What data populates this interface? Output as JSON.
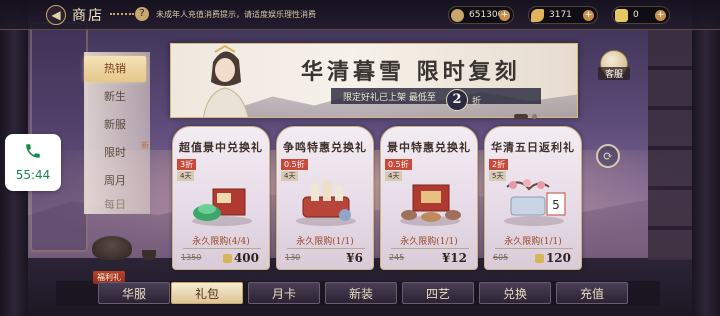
{
  "topbar": {
    "title": "商店",
    "notice": "未成年人充值消费提示，请适度娱乐理性消费",
    "help_symbol": "?",
    "back_symbol": "◀",
    "currencies": [
      {
        "icon": "coin-icon",
        "value": "651300"
      },
      {
        "icon": "feather-icon",
        "value": "3171"
      },
      {
        "icon": "ingot-icon",
        "value": "0"
      }
    ],
    "plus_symbol": "+"
  },
  "sidenav": {
    "items": [
      "热销",
      "新生",
      "新服",
      "限时",
      "周月",
      "每日"
    ],
    "active_index": 0,
    "new_tag": "新"
  },
  "banner": {
    "title": "华清暮雪 限时复刻",
    "subtitle": "限定好礼已上架 最低至",
    "discount": "2",
    "discount_suffix": "折"
  },
  "service": {
    "label": "客服"
  },
  "refresh_symbol": "⟳",
  "cards": [
    {
      "title": "超值景中兑换礼",
      "badge": "3折",
      "days": "4天",
      "limit": "永久限购(4/4)",
      "old_price": "1350",
      "price": "400",
      "price_icon": "ingot-icon"
    },
    {
      "title": "争鸣特惠兑换礼",
      "badge": "0.5折",
      "days": "4天",
      "limit": "永久限购(1/1)",
      "old_price": "130",
      "price": "¥6",
      "price_icon": ""
    },
    {
      "title": "景中特惠兑换礼",
      "badge": "0.5折",
      "days": "4天",
      "limit": "永久限购(1/1)",
      "old_price": "245",
      "price": "¥12",
      "price_icon": ""
    },
    {
      "title": "华清五日返利礼",
      "badge": "2折",
      "days": "5天",
      "limit": "永久限购(1/1)",
      "old_price": "605",
      "price": "120",
      "price_icon": "ingot-icon"
    }
  ],
  "tabs": {
    "items": [
      "华服",
      "礼包",
      "月卡",
      "新装",
      "四艺",
      "兑换",
      "充值"
    ],
    "active_index": 1,
    "welfare_badge": "福利礼"
  },
  "call_widget": {
    "time": "55:44"
  },
  "colors": {
    "accent_gold": "#c9a66b",
    "badge_red": "#c84a3a",
    "call_green": "#1a8a4a"
  }
}
